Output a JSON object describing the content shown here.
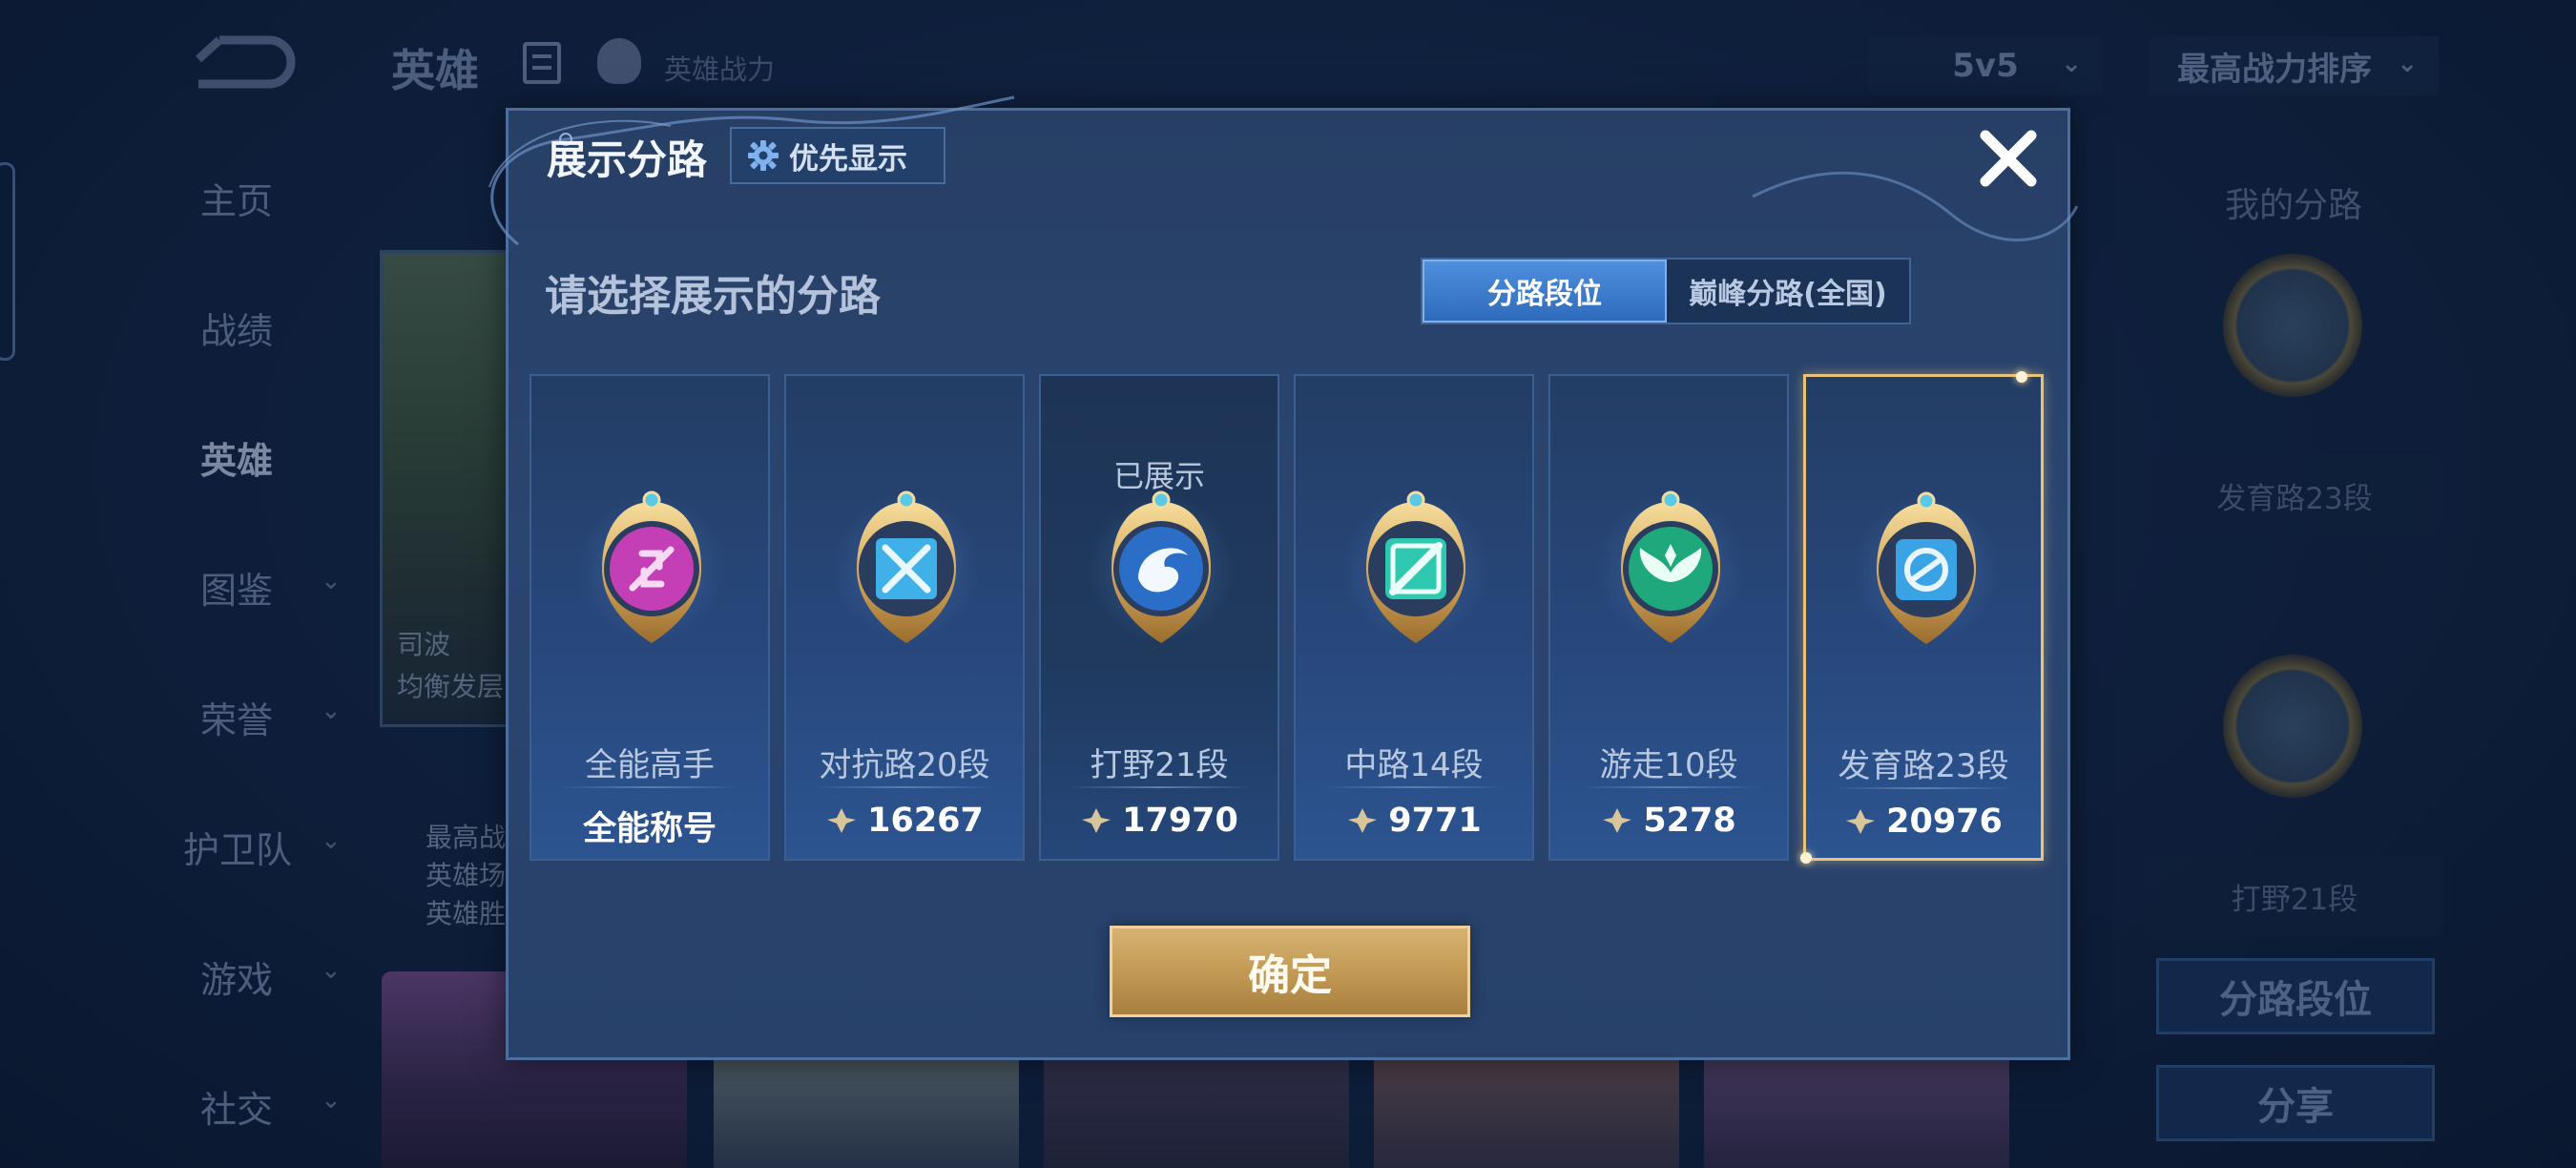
{
  "background": {
    "title": "英雄",
    "power_label": "英雄战力",
    "mode_select": "5v5",
    "sort_select": "最高战力排序",
    "nav": [
      {
        "label": "主页",
        "expandable": false,
        "active": false
      },
      {
        "label": "战绩",
        "expandable": false,
        "active": false
      },
      {
        "label": "英雄",
        "expandable": false,
        "active": true
      },
      {
        "label": "图鉴",
        "expandable": true,
        "active": false
      },
      {
        "label": "荣誉",
        "expandable": true,
        "active": false
      },
      {
        "label": "护卫队",
        "expandable": true,
        "active": false
      },
      {
        "label": "游戏",
        "expandable": true,
        "active": false
      },
      {
        "label": "社交",
        "expandable": true,
        "active": false
      }
    ],
    "hero_card": {
      "name_fragment": "司波",
      "role_fragment": "均衡发层",
      "stats_fragments": [
        "最高战",
        "英雄场",
        "英雄胜"
      ]
    },
    "right_panel": {
      "title": "我的分路",
      "lane_primary": "发育路23段",
      "lane_secondary": "打野21段",
      "lane_button": "分路段位",
      "share_button": "分享"
    }
  },
  "modal": {
    "title": "展示分路",
    "priority_button": "优先显示",
    "prompt": "请选择展示的分路",
    "segment": {
      "active": "分路段位",
      "inactive": "巅峰分路(全国)"
    },
    "confirm_button": "确定",
    "lanes": [
      {
        "name": "全能高手",
        "value": "全能称号",
        "shown": false,
        "selected": false,
        "color": "#c43fb5",
        "icon": "all-round-icon"
      },
      {
        "name": "对抗路20段",
        "value": "16267",
        "shown": false,
        "selected": false,
        "color": "#3fb0e8",
        "icon": "clash-lane-icon"
      },
      {
        "name": "打野21段",
        "value": "17970",
        "shown": true,
        "shown_label": "已展示",
        "selected": false,
        "color": "#2a6ec8",
        "icon": "jungle-dragon-icon"
      },
      {
        "name": "中路14段",
        "value": "9771",
        "shown": false,
        "selected": false,
        "color": "#2ec9b0",
        "icon": "mid-lane-icon"
      },
      {
        "name": "游走10段",
        "value": "5278",
        "shown": false,
        "selected": false,
        "color": "#1fa87c",
        "icon": "roam-wings-icon"
      },
      {
        "name": "发育路23段",
        "value": "20976",
        "shown": false,
        "selected": true,
        "color": "#3aa3e6",
        "icon": "farm-lane-icon"
      }
    ]
  }
}
